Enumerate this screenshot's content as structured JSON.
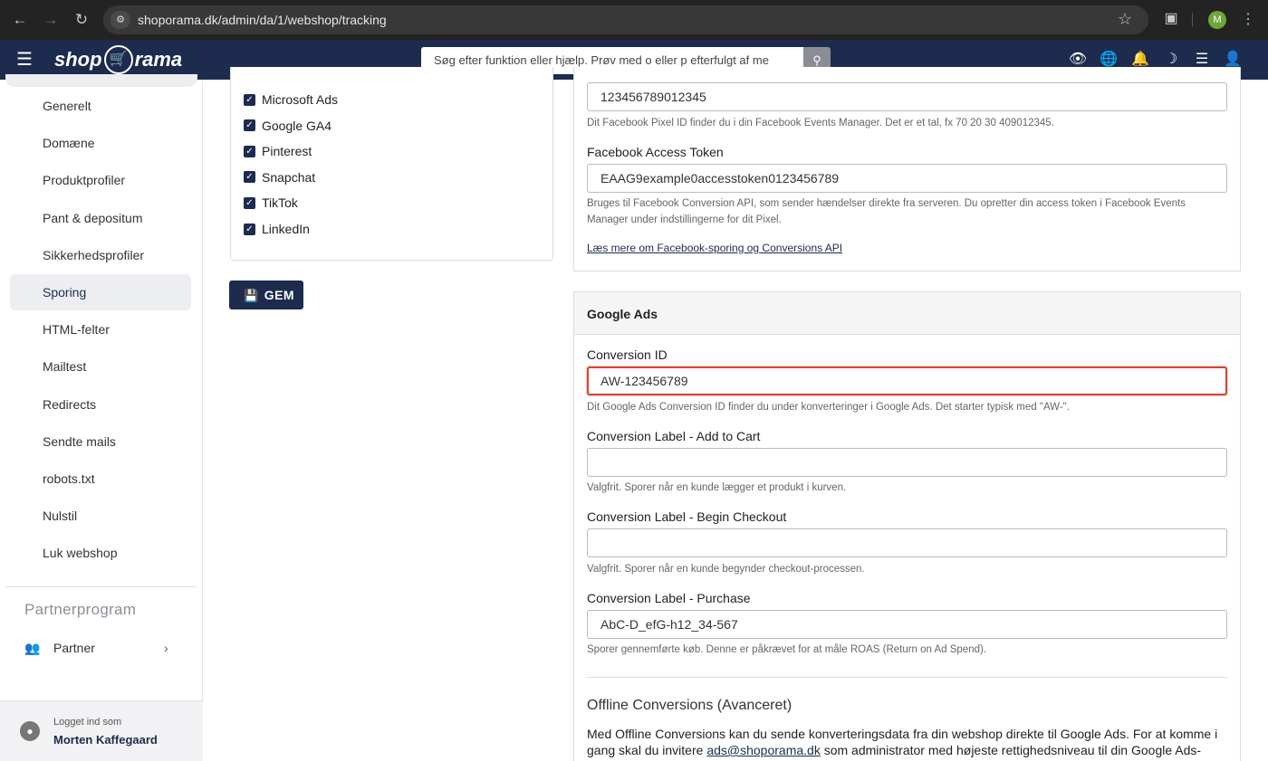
{
  "browser": {
    "url": "shoporama.dk/admin/da/1/webshop/tracking",
    "profile_initial": "M"
  },
  "app": {
    "logo_left": "shop",
    "logo_right": "rama",
    "search_placeholder": "Søg efter funktion eller hjælp. Prøv med o eller p efterfulgt af me"
  },
  "sidebar": {
    "items": [
      {
        "label": "Generelt"
      },
      {
        "label": "Domæne"
      },
      {
        "label": "Produktprofiler"
      },
      {
        "label": "Pant & depositum"
      },
      {
        "label": "Sikkerhedsprofiler"
      },
      {
        "label": "Sporing",
        "active": true
      },
      {
        "label": "HTML-felter"
      },
      {
        "label": "Mailtest"
      },
      {
        "label": "Redirects"
      },
      {
        "label": "Sendte mails"
      },
      {
        "label": "robots.txt"
      },
      {
        "label": "Nulstil"
      },
      {
        "label": "Luk webshop"
      }
    ],
    "partner_heading": "Partnerprogram",
    "partner_item": "Partner",
    "logged_in_label": "Logget ind som",
    "user_name": "Morten Kaffegaard"
  },
  "channels": {
    "items": [
      {
        "label": "Microsoft Ads",
        "checked": true
      },
      {
        "label": "Google GA4",
        "checked": true
      },
      {
        "label": "Pinterest",
        "checked": true
      },
      {
        "label": "Snapchat",
        "checked": true
      },
      {
        "label": "TikTok",
        "checked": true
      },
      {
        "label": "LinkedIn",
        "checked": true
      }
    ],
    "save_label": "GEM"
  },
  "facebook": {
    "pixel_id_value": "123456789012345",
    "pixel_id_help": "Dit Facebook Pixel ID finder du i din Facebook Events Manager. Det er et tal, fx 70 20 30 409012345.",
    "access_token_label": "Facebook Access Token",
    "access_token_value": "EAAG9example0accesstoken0123456789",
    "access_token_help": "Bruges til Facebook Conversion API, som sender hændelser direkte fra serveren. Du opretter din access token i Facebook Events Manager under indstillingerne for dit Pixel.",
    "read_more_link": "Læs mere om Facebook-sporing og Conversions API"
  },
  "google_ads": {
    "title": "Google Ads",
    "conversion_id_label": "Conversion ID",
    "conversion_id_value": "AW-123456789",
    "conversion_id_help": "Dit Google Ads Conversion ID finder du under konverteringer i Google Ads. Det starter typisk med \"AW-\".",
    "add_to_cart_label": "Conversion Label - Add to Cart",
    "add_to_cart_value": "",
    "add_to_cart_help": "Valgfrit. Sporer når en kunde lægger et produkt i kurven.",
    "begin_checkout_label": "Conversion Label - Begin Checkout",
    "begin_checkout_value": "",
    "begin_checkout_help": "Valgfrit. Sporer når en kunde begynder checkout-processen.",
    "purchase_label": "Conversion Label - Purchase",
    "purchase_value": "AbC-D_efG-h12_34-567",
    "purchase_help": "Sporer gennemførte køb. Denne er påkrævet for at måle ROAS (Return on Ad Spend).",
    "offline_title": "Offline Conversions (Avanceret)",
    "offline_text_before": "Med Offline Conversions kan du sende konverteringsdata fra din webshop direkte til Google Ads. For at komme i gang skal du invitere ",
    "offline_email": "ads@shoporama.dk",
    "offline_text_after": " som administrator med højeste rettighedsniveau til din Google Ads-konto."
  }
}
